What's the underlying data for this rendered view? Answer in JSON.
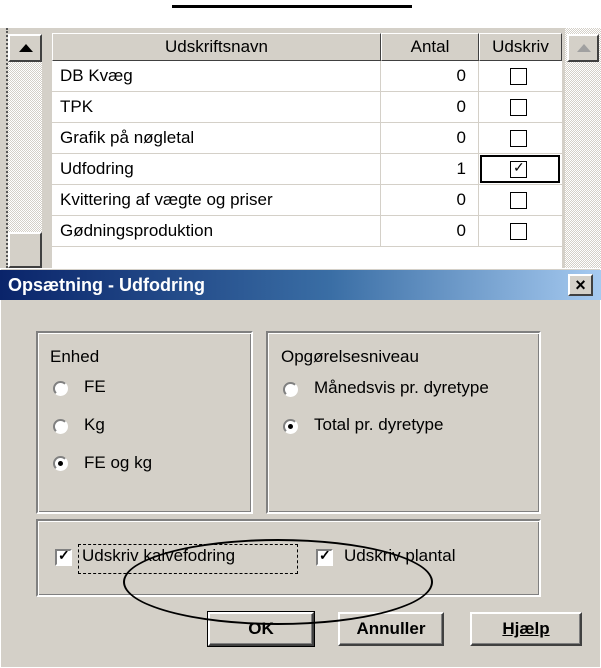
{
  "grid": {
    "columns": [
      "Udskriftsnavn",
      "Antal",
      "Udskriv"
    ],
    "rows": [
      {
        "name": "DB Kvæg",
        "count": "0",
        "checked": false
      },
      {
        "name": "TPK",
        "count": "0",
        "checked": false
      },
      {
        "name": "Grafik på nøgletal",
        "count": "0",
        "checked": false
      },
      {
        "name": "Udfodring",
        "count": "1",
        "checked": true
      },
      {
        "name": "Kvittering af vægte og priser",
        "count": "0",
        "checked": false
      },
      {
        "name": "Gødningsproduktion",
        "count": "0",
        "checked": false
      }
    ],
    "check_glyph": "✓"
  },
  "dialog": {
    "title": "Opsætning - Udfodring",
    "close_glyph": "×",
    "enhed": {
      "title": "Enhed",
      "options": [
        {
          "label": "FE",
          "selected": false
        },
        {
          "label": "Kg",
          "selected": false
        },
        {
          "label": "FE og kg",
          "selected": true
        }
      ]
    },
    "opgoerelse": {
      "title": "Opgørelsesniveau",
      "options": [
        {
          "label": "Månedsvis pr. dyretype",
          "selected": false
        },
        {
          "label": "Total pr. dyretype",
          "selected": true
        }
      ]
    },
    "checkboxes": {
      "kalvefodring": {
        "label": "Udskriv kalvefodring",
        "checked": true
      },
      "plantal": {
        "label": "Udskriv plantal",
        "checked": true
      }
    },
    "buttons": {
      "ok": "OK",
      "cancel": "Annuller",
      "help": "Hjælp"
    }
  }
}
